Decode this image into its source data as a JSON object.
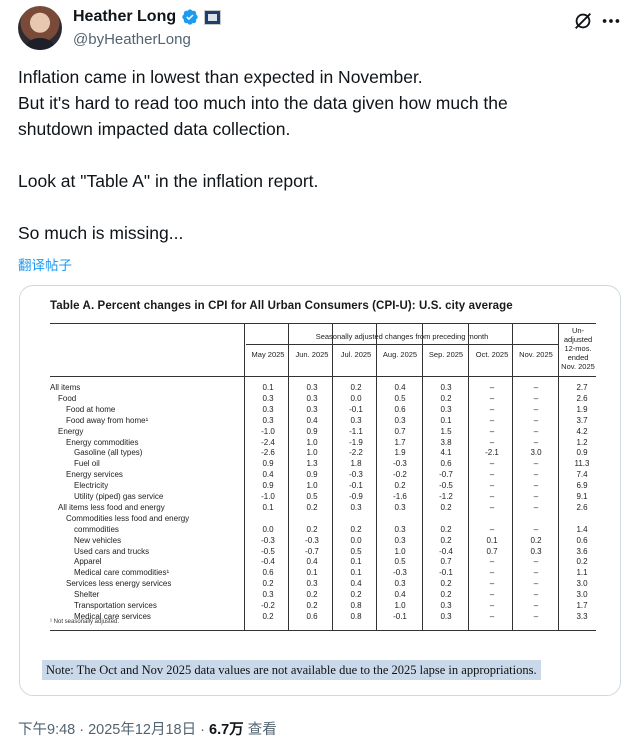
{
  "author": {
    "name": "Heather Long",
    "handle": "@byHeatherLong"
  },
  "tweet": {
    "lines": [
      "Inflation came in lowest than expected in November.",
      "But it's hard to read too much into the data given how much the",
      "shutdown impacted data collection.",
      "Look at \"Table A\" in the inflation report.",
      "So much is missing..."
    ],
    "translate_label": "翻译帖子"
  },
  "table": {
    "title": "Table A. Percent changes in CPI for All Urban Consumers (CPI-U): U.S. city average",
    "group_header": "Seasonally adjusted changes from preceding month",
    "col_headers": [
      [
        "May",
        "2025"
      ],
      [
        "Jun.",
        "2025"
      ],
      [
        "Jul.",
        "2025"
      ],
      [
        "Aug.",
        "2025"
      ],
      [
        "Sep.",
        "2025"
      ],
      [
        "Oct.",
        "2025"
      ],
      [
        "Nov.",
        "2025"
      ]
    ],
    "last_header": [
      "Un-",
      "adjusted",
      "12-mos.",
      "ended",
      "Nov. 2025"
    ],
    "rows": [
      {
        "label": "All items",
        "indent": 0,
        "vals": [
          "0.1",
          "0.3",
          "0.2",
          "0.4",
          "0.3",
          "–",
          "–",
          "2.7"
        ]
      },
      {
        "label": "Food",
        "indent": 1,
        "vals": [
          "0.3",
          "0.3",
          "0.0",
          "0.5",
          "0.2",
          "–",
          "–",
          "2.6"
        ]
      },
      {
        "label": "Food at home",
        "indent": 2,
        "vals": [
          "0.3",
          "0.3",
          "-0.1",
          "0.6",
          "0.3",
          "–",
          "–",
          "1.9"
        ]
      },
      {
        "label": "Food away from home¹",
        "indent": 2,
        "vals": [
          "0.3",
          "0.4",
          "0.3",
          "0.3",
          "0.1",
          "–",
          "–",
          "3.7"
        ]
      },
      {
        "label": "Energy",
        "indent": 1,
        "vals": [
          "-1.0",
          "0.9",
          "-1.1",
          "0.7",
          "1.5",
          "–",
          "–",
          "4.2"
        ]
      },
      {
        "label": "Energy commodities",
        "indent": 2,
        "vals": [
          "-2.4",
          "1.0",
          "-1.9",
          "1.7",
          "3.8",
          "–",
          "–",
          "1.2"
        ]
      },
      {
        "label": "Gasoline (all types)",
        "indent": 3,
        "vals": [
          "-2.6",
          "1.0",
          "-2.2",
          "1.9",
          "4.1",
          "-2.1",
          "3.0",
          "0.9"
        ]
      },
      {
        "label": "Fuel oil",
        "indent": 3,
        "vals": [
          "0.9",
          "1.3",
          "1.8",
          "-0.3",
          "0.6",
          "–",
          "–",
          "11.3"
        ]
      },
      {
        "label": "Energy services",
        "indent": 2,
        "vals": [
          "0.4",
          "0.9",
          "-0.3",
          "-0.2",
          "-0.7",
          "–",
          "–",
          "7.4"
        ]
      },
      {
        "label": "Electricity",
        "indent": 3,
        "vals": [
          "0.9",
          "1.0",
          "-0.1",
          "0.2",
          "-0.5",
          "–",
          "–",
          "6.9"
        ]
      },
      {
        "label": "Utility (piped) gas service",
        "indent": 3,
        "vals": [
          "-1.0",
          "0.5",
          "-0.9",
          "-1.6",
          "-1.2",
          "–",
          "–",
          "9.1"
        ]
      },
      {
        "label": "All items less food and energy",
        "indent": 1,
        "vals": [
          "0.1",
          "0.2",
          "0.3",
          "0.3",
          "0.2",
          "–",
          "–",
          "2.6"
        ]
      },
      {
        "label": "Commodities less food and energy",
        "indent": 2,
        "vals": [
          "",
          "",
          "",
          "",
          "",
          "",
          "",
          ""
        ]
      },
      {
        "label": "commodities",
        "indent": 3,
        "vals": [
          "0.0",
          "0.2",
          "0.2",
          "0.3",
          "0.2",
          "–",
          "–",
          "1.4"
        ]
      },
      {
        "label": "New vehicles",
        "indent": 3,
        "vals": [
          "-0.3",
          "-0.3",
          "0.0",
          "0.3",
          "0.2",
          "0.1",
          "0.2",
          "0.6"
        ]
      },
      {
        "label": "Used cars and trucks",
        "indent": 3,
        "vals": [
          "-0.5",
          "-0.7",
          "0.5",
          "1.0",
          "-0.4",
          "0.7",
          "0.3",
          "3.6"
        ]
      },
      {
        "label": "Apparel",
        "indent": 3,
        "vals": [
          "-0.4",
          "0.4",
          "0.1",
          "0.5",
          "0.7",
          "–",
          "–",
          "0.2"
        ]
      },
      {
        "label": "Medical care commodities¹",
        "indent": 3,
        "vals": [
          "0.6",
          "0.1",
          "0.1",
          "-0.3",
          "-0.1",
          "–",
          "–",
          "1.1"
        ]
      },
      {
        "label": "Services less energy services",
        "indent": 2,
        "vals": [
          "0.2",
          "0.3",
          "0.4",
          "0.3",
          "0.2",
          "–",
          "–",
          "3.0"
        ]
      },
      {
        "label": "Shelter",
        "indent": 3,
        "vals": [
          "0.3",
          "0.2",
          "0.2",
          "0.4",
          "0.2",
          "–",
          "–",
          "3.0"
        ]
      },
      {
        "label": "Transportation services",
        "indent": 3,
        "vals": [
          "-0.2",
          "0.2",
          "0.8",
          "1.0",
          "0.3",
          "–",
          "–",
          "1.7"
        ]
      },
      {
        "label": "Medical care services",
        "indent": 3,
        "vals": [
          "0.2",
          "0.6",
          "0.8",
          "-0.1",
          "0.3",
          "–",
          "–",
          "3.3"
        ]
      }
    ],
    "footnote": "¹ Not seasonally adjusted.",
    "note": "Note: The Oct and Nov 2025 data values are not available due to the 2025 lapse in appropriations."
  },
  "meta": {
    "time": "下午9:48 · 2025年12月18日 · ",
    "views": "6.7万",
    "views_label": " 查看"
  }
}
